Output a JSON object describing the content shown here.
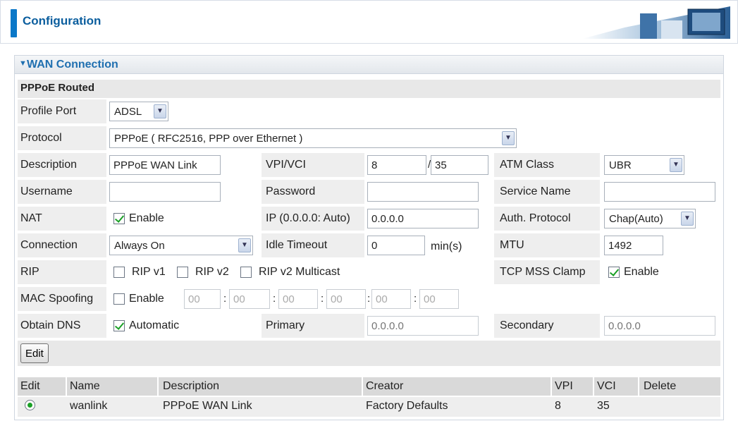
{
  "header": {
    "title": "Configuration"
  },
  "section": {
    "title": "WAN Connection",
    "subtitle": "PPPoE Routed"
  },
  "form": {
    "profile_port": {
      "label": "Profile Port",
      "value": "ADSL"
    },
    "protocol": {
      "label": "Protocol",
      "value": "PPPoE ( RFC2516, PPP over Ethernet )"
    },
    "description": {
      "label": "Description",
      "value": "PPPoE WAN Link"
    },
    "vpi_vci": {
      "label": "VPI/VCI",
      "vpi": "8",
      "vci": "35",
      "separator": "/"
    },
    "atm_class": {
      "label": "ATM Class",
      "value": "UBR"
    },
    "username": {
      "label": "Username",
      "value": ""
    },
    "password": {
      "label": "Password",
      "value": ""
    },
    "service_name": {
      "label": "Service Name",
      "value": ""
    },
    "nat": {
      "label": "NAT",
      "option": "Enable",
      "checked": true
    },
    "ip": {
      "label": "IP (0.0.0.0: Auto)",
      "value": "0.0.0.0"
    },
    "auth_protocol": {
      "label": "Auth. Protocol",
      "value": "Chap(Auto)"
    },
    "connection": {
      "label": "Connection",
      "value": "Always On"
    },
    "idle_timeout": {
      "label": "Idle Timeout",
      "value": "0",
      "unit": "min(s)"
    },
    "mtu": {
      "label": "MTU",
      "value": "1492"
    },
    "rip": {
      "label": "RIP",
      "v1": "RIP v1",
      "v2": "RIP v2",
      "v2m": "RIP v2 Multicast"
    },
    "tcp_mss": {
      "label": "TCP MSS Clamp",
      "option": "Enable",
      "checked": true
    },
    "mac_spoofing": {
      "label": "MAC Spoofing",
      "option": "Enable",
      "checked": false,
      "octets": [
        "00",
        "00",
        "00",
        "00",
        "00",
        "00"
      ],
      "separator": ":"
    },
    "obtain_dns": {
      "label": "Obtain DNS",
      "option": "Automatic",
      "checked": true
    },
    "primary": {
      "label": "Primary",
      "placeholder": "0.0.0.0"
    },
    "secondary": {
      "label": "Secondary",
      "placeholder": "0.0.0.0"
    },
    "edit_label": "Edit"
  },
  "table": {
    "headers": [
      "Edit",
      "Name",
      "Description",
      "Creator",
      "VPI",
      "VCI",
      "Delete"
    ],
    "rows": [
      {
        "name": "wanlink",
        "description": "PPPoE WAN Link",
        "creator": "Factory Defaults",
        "vpi": "8",
        "vci": "35"
      }
    ]
  },
  "colors": {
    "accent": "#0b78c8",
    "title": "#0b5e9e",
    "check": "#1aa026"
  }
}
